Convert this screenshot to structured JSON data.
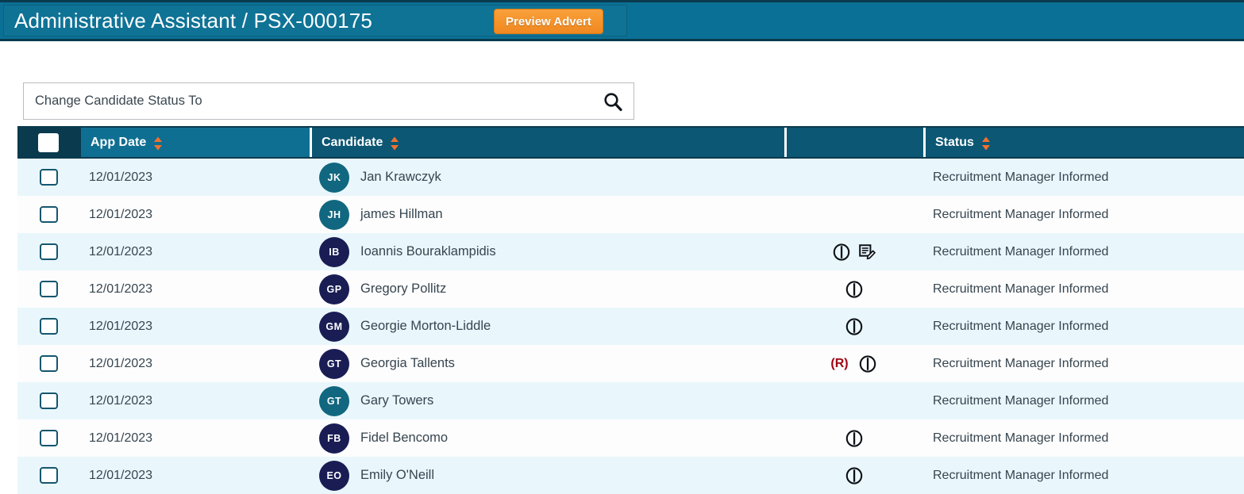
{
  "banner": {
    "title": "Administrative Assistant / PSX-000175",
    "preview_button": "Preview Advert",
    "bg_color": "#0b7095",
    "button_color": "#f08820"
  },
  "search": {
    "value": "",
    "placeholder": "Change Candidate Status To",
    "icon": "search-icon"
  },
  "table": {
    "columns": [
      {
        "key": "select",
        "label": "",
        "sortable": false
      },
      {
        "key": "app_date",
        "label": "App Date",
        "sortable": true
      },
      {
        "key": "candidate",
        "label": "Candidate",
        "sortable": true
      },
      {
        "key": "icons",
        "label": "",
        "sortable": false
      },
      {
        "key": "status",
        "label": "Status",
        "sortable": true
      }
    ],
    "select_all_checked": false,
    "rows": [
      {
        "checked": false,
        "app_date": "12/01/2023",
        "initials": "JK",
        "avatar_color": "#11677f",
        "name": "Jan Krawczyk",
        "rejected_flag": "",
        "icons": [],
        "status": "Recruitment Manager Informed"
      },
      {
        "checked": false,
        "app_date": "12/01/2023",
        "initials": "JH",
        "avatar_color": "#11677f",
        "name": "james Hillman",
        "rejected_flag": "",
        "icons": [],
        "status": "Recruitment Manager Informed"
      },
      {
        "checked": false,
        "app_date": "12/01/2023",
        "initials": "IB",
        "avatar_color": "#191d54",
        "name": "Ioannis Bouraklampidis",
        "rejected_flag": "",
        "icons": [
          "info-circle-icon",
          "document-edit-icon"
        ],
        "status": "Recruitment Manager Informed"
      },
      {
        "checked": false,
        "app_date": "12/01/2023",
        "initials": "GP",
        "avatar_color": "#191d54",
        "name": "Gregory Pollitz",
        "rejected_flag": "",
        "icons": [
          "info-circle-icon"
        ],
        "status": "Recruitment Manager Informed"
      },
      {
        "checked": false,
        "app_date": "12/01/2023",
        "initials": "GM",
        "avatar_color": "#191d54",
        "name": "Georgie Morton-Liddle",
        "rejected_flag": "",
        "icons": [
          "info-circle-icon"
        ],
        "status": "Recruitment Manager Informed"
      },
      {
        "checked": false,
        "app_date": "12/01/2023",
        "initials": "GT",
        "avatar_color": "#191d54",
        "name": "Georgia Tallents",
        "rejected_flag": "(R)",
        "icons": [
          "info-circle-icon"
        ],
        "status": "Recruitment Manager Informed"
      },
      {
        "checked": false,
        "app_date": "12/01/2023",
        "initials": "GT",
        "avatar_color": "#11677f",
        "name": "Gary Towers",
        "rejected_flag": "",
        "icons": [],
        "status": "Recruitment Manager Informed"
      },
      {
        "checked": false,
        "app_date": "12/01/2023",
        "initials": "FB",
        "avatar_color": "#191d54",
        "name": "Fidel Bencomo",
        "rejected_flag": "",
        "icons": [
          "info-circle-icon"
        ],
        "status": "Recruitment Manager Informed"
      },
      {
        "checked": false,
        "app_date": "12/01/2023",
        "initials": "EO",
        "avatar_color": "#191d54",
        "name": "Emily O'Neill",
        "rejected_flag": "",
        "icons": [
          "info-circle-icon"
        ],
        "status": "Recruitment Manager Informed"
      }
    ]
  },
  "colors": {
    "header_dark": "#0a3a4e",
    "header_mid": "#0c5773",
    "header_light": "#0f6f92",
    "row_odd": "#e9f7fc",
    "row_even": "#fdfdfd",
    "sort_arrow": "#f0712f",
    "rejected": "#a30013"
  }
}
